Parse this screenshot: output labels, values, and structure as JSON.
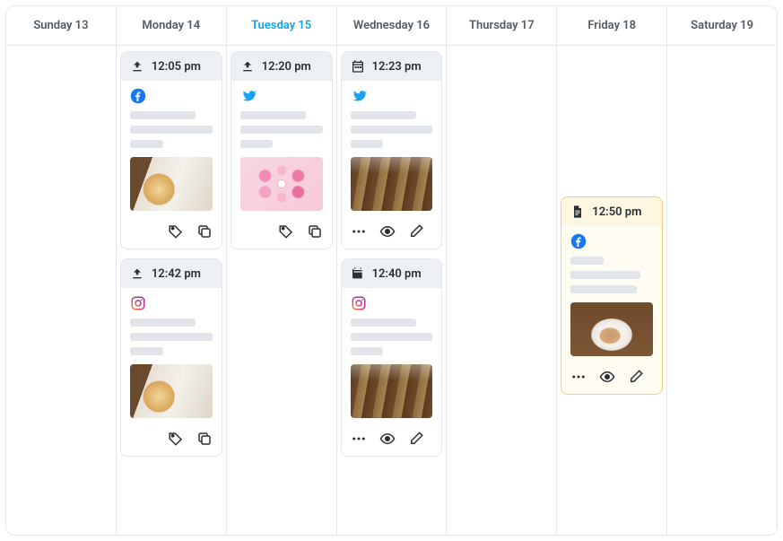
{
  "days": [
    {
      "label": "Sunday 13",
      "today": false
    },
    {
      "label": "Monday 14",
      "today": false
    },
    {
      "label": "Tuesday 15",
      "today": true
    },
    {
      "label": "Wednesday 16",
      "today": false
    },
    {
      "label": "Thursday 17",
      "today": false
    },
    {
      "label": "Friday 18",
      "today": false
    },
    {
      "label": "Saturday 19",
      "today": false
    }
  ],
  "posts": {
    "sunday": [],
    "monday": [
      {
        "time": "12:05 pm",
        "status": "sent",
        "platform": "facebook",
        "thumb": "burger",
        "actions": [
          "tag",
          "copy"
        ],
        "footer_align": "right"
      },
      {
        "time": "12:42 pm",
        "status": "sent",
        "platform": "instagram",
        "thumb": "burger",
        "actions": [
          "tag",
          "copy"
        ],
        "footer_align": "right"
      }
    ],
    "tuesday": [
      {
        "time": "12:20 pm",
        "status": "sent",
        "platform": "twitter",
        "thumb": "flowers",
        "actions": [
          "tag",
          "copy"
        ],
        "footer_align": "right"
      }
    ],
    "wednesday": [
      {
        "time": "12:23 pm",
        "status": "scheduled",
        "platform": "twitter",
        "thumb": "iced",
        "actions": [
          "more",
          "preview",
          "edit"
        ],
        "footer_align": "left"
      },
      {
        "time": "12:40 pm",
        "status": "scheduled",
        "platform": "instagram",
        "thumb": "iced",
        "actions": [
          "more",
          "preview",
          "edit"
        ],
        "footer_align": "left"
      }
    ],
    "thursday": [],
    "friday": [
      {
        "time": "12:50 pm",
        "status": "draft",
        "platform": "facebook",
        "thumb": "latte",
        "actions": [
          "more",
          "preview",
          "edit"
        ],
        "footer_align": "left"
      }
    ],
    "saturday": []
  },
  "icons": {
    "sent": "upload-icon",
    "scheduled": "calendar-icon",
    "draft": "document-icon",
    "tag": "tag-icon",
    "copy": "copy-icon",
    "more": "more-icon",
    "preview": "eye-icon",
    "edit": "pencil-icon",
    "facebook": "facebook-icon",
    "twitter": "twitter-icon",
    "instagram": "instagram-icon"
  },
  "colors": {
    "facebook": "#1877f2",
    "twitter": "#1da1f2",
    "instagram_grad_a": "#f58529",
    "instagram_grad_b": "#dd2a7b",
    "instagram_grad_c": "#8134af",
    "today": "#0ea5e9",
    "draft_border": "#f2d37a",
    "draft_bg": "#fffcf2"
  }
}
